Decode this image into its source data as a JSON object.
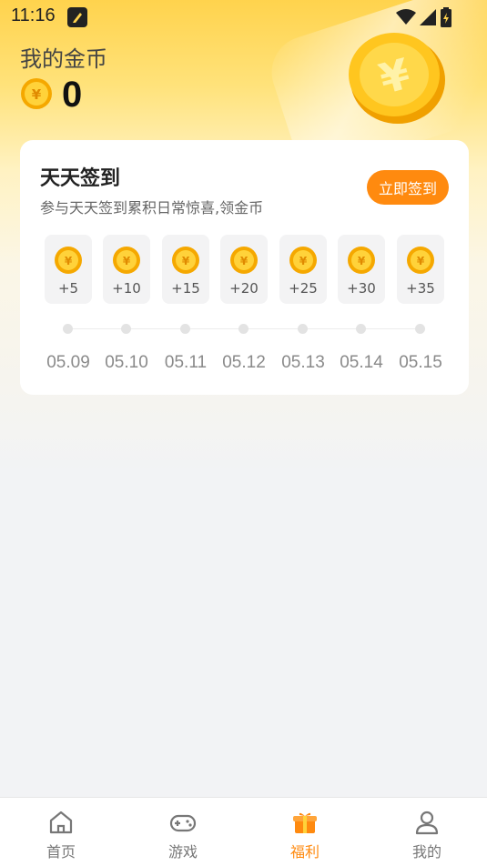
{
  "status_bar": {
    "time": "11:16"
  },
  "header": {
    "title": "我的金币",
    "coin_count": "0"
  },
  "checkin": {
    "title": "天天签到",
    "subtitle": "参与天天签到累积日常惊喜,领金币",
    "button_label": "立即签到",
    "days": [
      {
        "amount": "+5",
        "date": "05.09"
      },
      {
        "amount": "+10",
        "date": "05.10"
      },
      {
        "amount": "+15",
        "date": "05.11"
      },
      {
        "amount": "+20",
        "date": "05.12"
      },
      {
        "amount": "+25",
        "date": "05.13"
      },
      {
        "amount": "+30",
        "date": "05.14"
      },
      {
        "amount": "+35",
        "date": "05.15"
      }
    ]
  },
  "tabs": [
    {
      "label": "首页",
      "icon": "home-icon",
      "active": false
    },
    {
      "label": "游戏",
      "icon": "gamepad-icon",
      "active": false
    },
    {
      "label": "福利",
      "icon": "gift-icon",
      "active": true
    },
    {
      "label": "我的",
      "icon": "user-icon",
      "active": false
    }
  ],
  "colors": {
    "accent": "#ff8a0f",
    "coin": "#ffc21a"
  }
}
